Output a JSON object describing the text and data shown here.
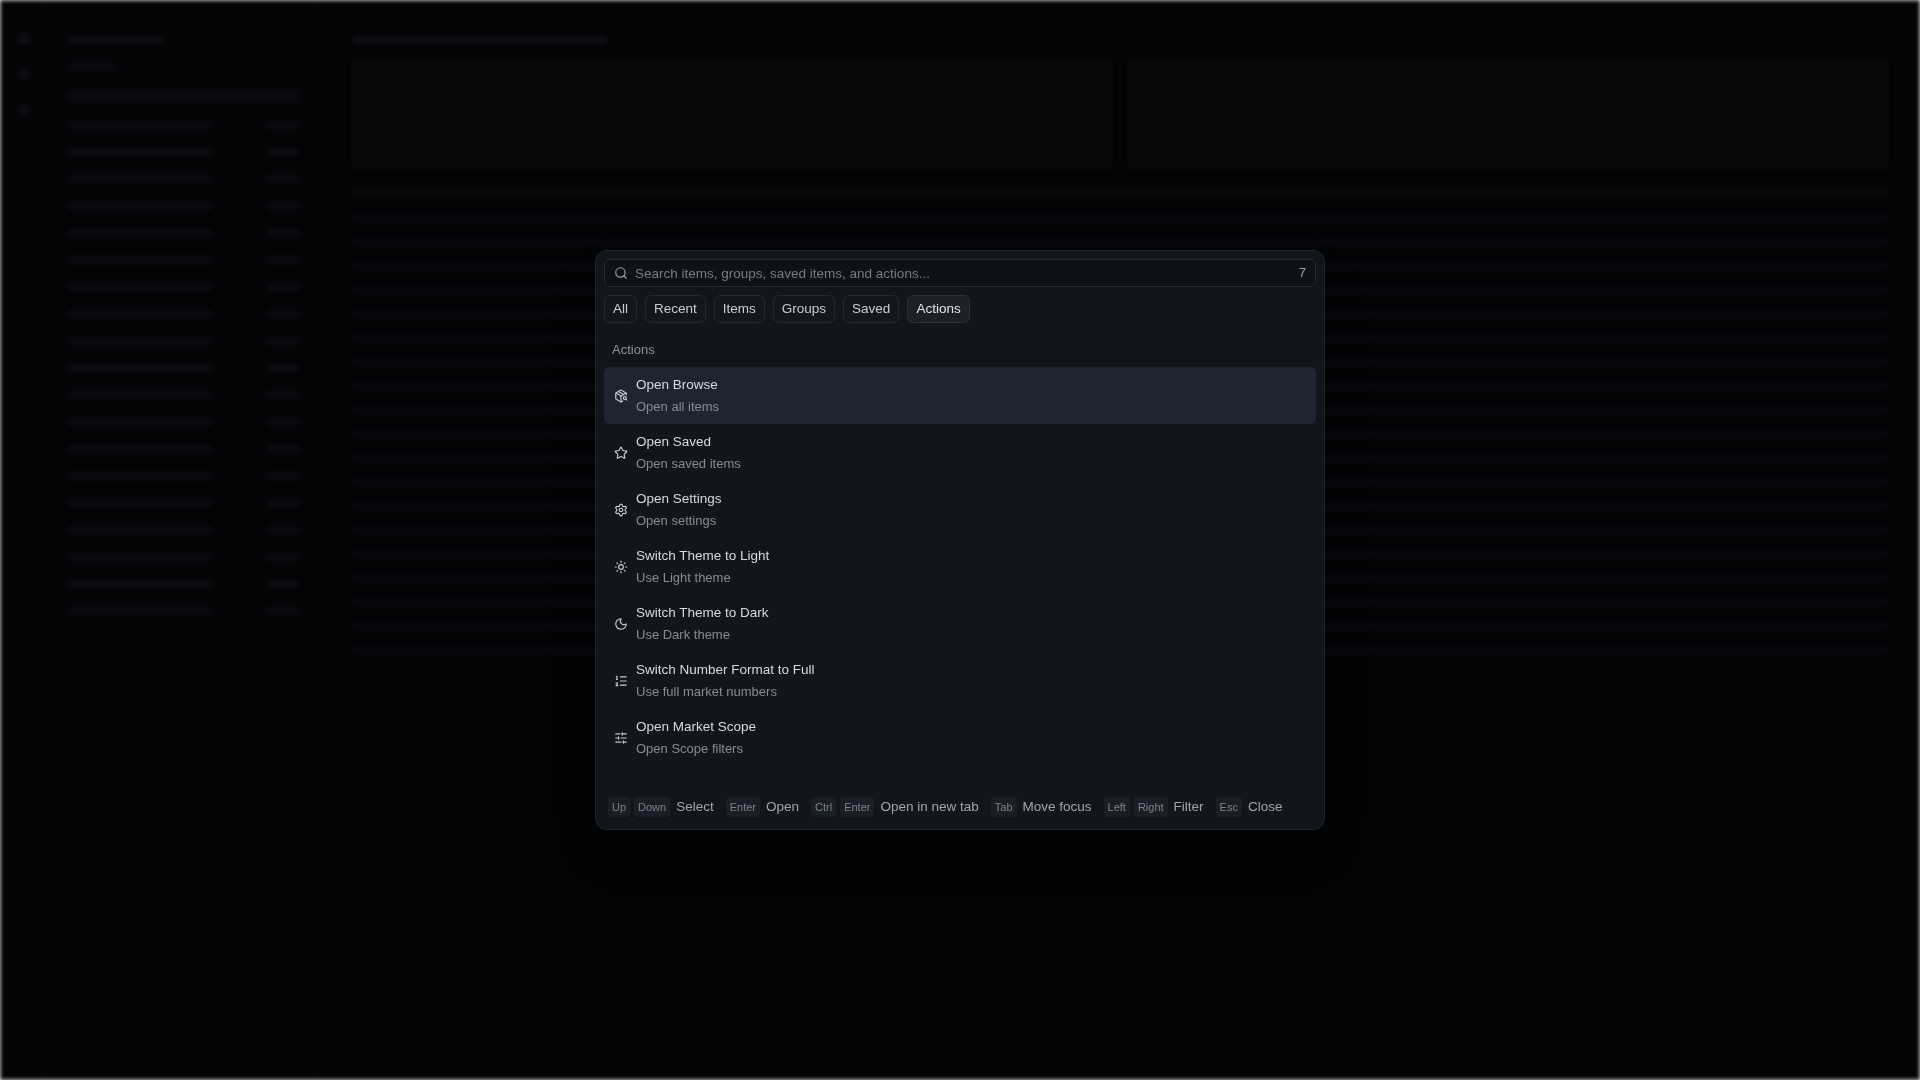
{
  "command_palette": {
    "search": {
      "placeholder": "Search items, groups, saved items, and actions...",
      "count": "7"
    },
    "filter_tabs": [
      {
        "label": "All",
        "selected": false
      },
      {
        "label": "Recent",
        "selected": false
      },
      {
        "label": "Items",
        "selected": false
      },
      {
        "label": "Groups",
        "selected": false
      },
      {
        "label": "Saved",
        "selected": false
      },
      {
        "label": "Actions",
        "selected": true
      }
    ],
    "sections": [
      {
        "heading": "Actions",
        "items": [
          {
            "title": "Open Browse",
            "subtitle": "Open all items",
            "selected": true
          },
          {
            "title": "Open Saved",
            "subtitle": "Open saved items",
            "selected": false
          },
          {
            "title": "Open Settings",
            "subtitle": "Open settings",
            "selected": false
          },
          {
            "title": "Switch Theme to Light",
            "subtitle": "Use Light theme",
            "selected": false
          },
          {
            "title": "Switch Theme to Dark",
            "subtitle": "Use Dark theme",
            "selected": false
          },
          {
            "title": "Switch Number Format to Full",
            "subtitle": "Use full market numbers",
            "selected": false
          },
          {
            "title": "Open Market Scope",
            "subtitle": "Open Scope filters",
            "selected": false
          }
        ]
      }
    ],
    "shortcuts": [
      {
        "keys": [
          "Up",
          "Down"
        ],
        "label": "Select"
      },
      {
        "keys": [
          "Enter"
        ],
        "label": "Open"
      },
      {
        "keys": [
          "Ctrl",
          "Enter"
        ],
        "label": "Open in new tab"
      },
      {
        "keys": [
          "Tab"
        ],
        "label": "Move focus"
      },
      {
        "keys": [
          "Left",
          "Right"
        ],
        "label": "Filter"
      },
      {
        "keys": [
          "Esc"
        ],
        "label": "Close"
      }
    ]
  }
}
